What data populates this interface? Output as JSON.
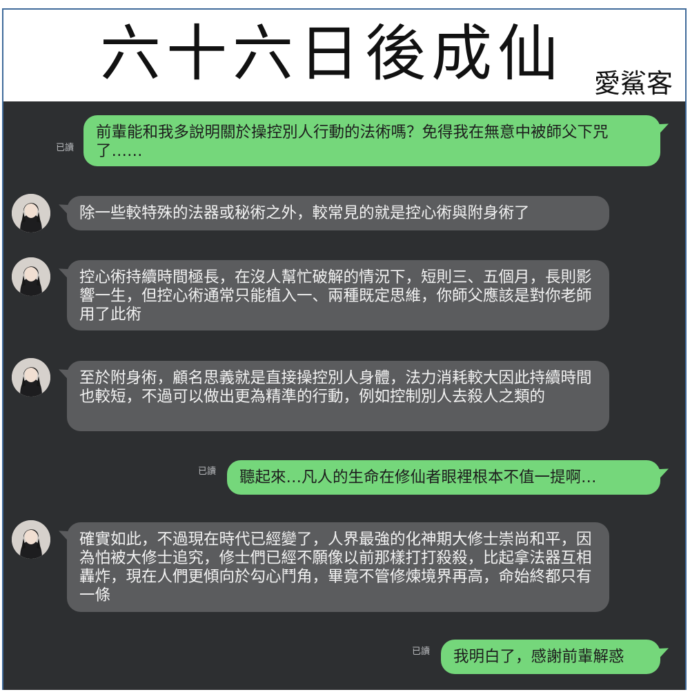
{
  "header": {
    "title": "六十六日後成仙",
    "author": "愛鯊客"
  },
  "read_label": "已讀",
  "messages": [
    {
      "side": "out",
      "text": "前輩能和我多說明關於操控別人行動的法術嗎？免得我在無意中被師父下咒了……"
    },
    {
      "side": "in",
      "text": "除一些較特殊的法器或秘術之外，較常見的就是控心術與附身術了"
    },
    {
      "side": "in",
      "text": "控心術持續時間極長，在沒人幫忙破解的情況下，短則三、五個月，長則影響一生，但控心術通常只能植入一、兩種既定思維，你師父應該是對你老師用了此術"
    },
    {
      "side": "in",
      "text": "至於附身術，顧名思義就是直接操控別人身體，法力消耗較大因此持續時間也較短，不過可以做出更為精準的行動，例如控制別人去殺人之類的"
    },
    {
      "side": "out",
      "text": "聽起來…凡人的生命在修仙者眼裡根本不值一提啊…"
    },
    {
      "side": "in",
      "text": "確實如此，不過現在時代已經變了，人界最強的化神期大修士崇尚和平，因為怕被大修士追究，修士們已經不願像以前那樣打打殺殺，比起拿法器互相轟炸，現在人們更傾向於勾心鬥角，畢竟不管修煉境界再高，命始終都只有一條"
    },
    {
      "side": "out",
      "text": "我明白了，感謝前輩解惑"
    }
  ]
}
